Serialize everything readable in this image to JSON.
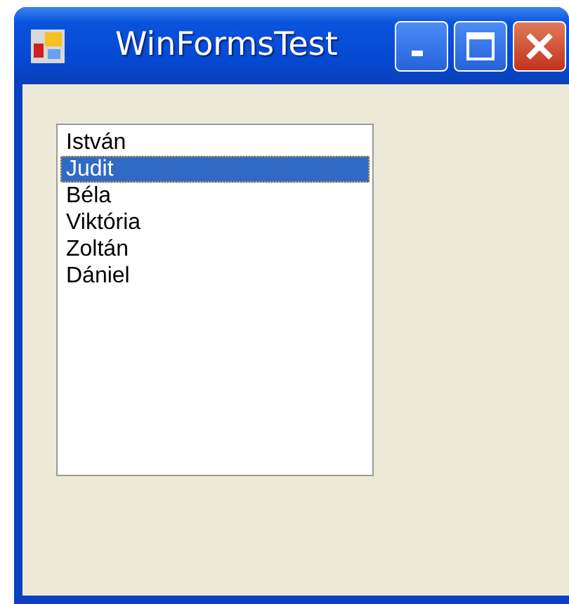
{
  "window": {
    "title": "WinFormsTest"
  },
  "listbox": {
    "items": [
      {
        "label": "István",
        "selected": false
      },
      {
        "label": "Judit",
        "selected": true
      },
      {
        "label": "Béla",
        "selected": false
      },
      {
        "label": "Viktória",
        "selected": false
      },
      {
        "label": "Zoltán",
        "selected": false
      },
      {
        "label": "Dániel",
        "selected": false
      }
    ]
  }
}
